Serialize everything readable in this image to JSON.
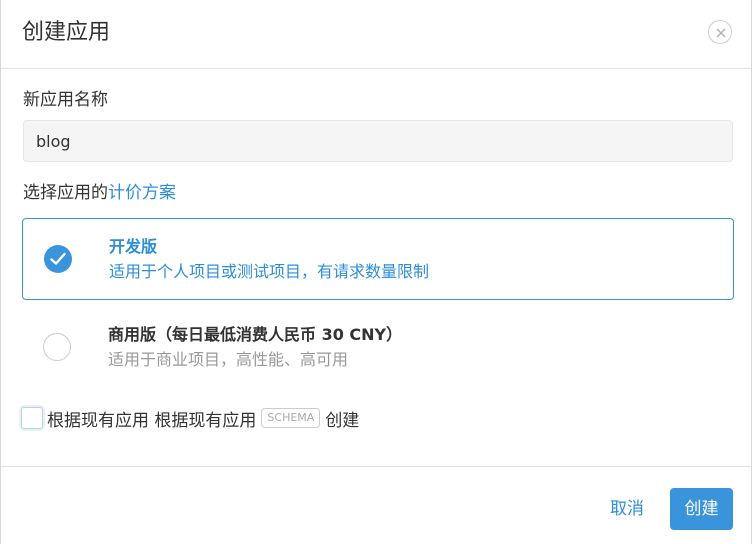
{
  "dialog": {
    "title": "创建应用",
    "close_icon": "close-icon"
  },
  "form": {
    "name_label": "新应用名称",
    "name_value": "blog",
    "plan_label_prefix": "选择应用的",
    "plan_label_link": "计价方案"
  },
  "plans": [
    {
      "title": "开发版",
      "description": "适用于个人项目或测试项目，有请求数量限制",
      "selected": true
    },
    {
      "title": "商用版（每日最低消费人民币 30 CNY）",
      "description": "适用于商业项目，高性能、高可用",
      "selected": false
    }
  ],
  "schema_option": {
    "checked": false,
    "text_before": "根据现有应用 根据现有应用",
    "tag": "SCHEMA",
    "text_after": "创建"
  },
  "footer": {
    "cancel_label": "取消",
    "create_label": "创建"
  },
  "colors": {
    "accent": "#3a94dc",
    "link": "#2d8ed8",
    "muted_text": "#999999"
  }
}
